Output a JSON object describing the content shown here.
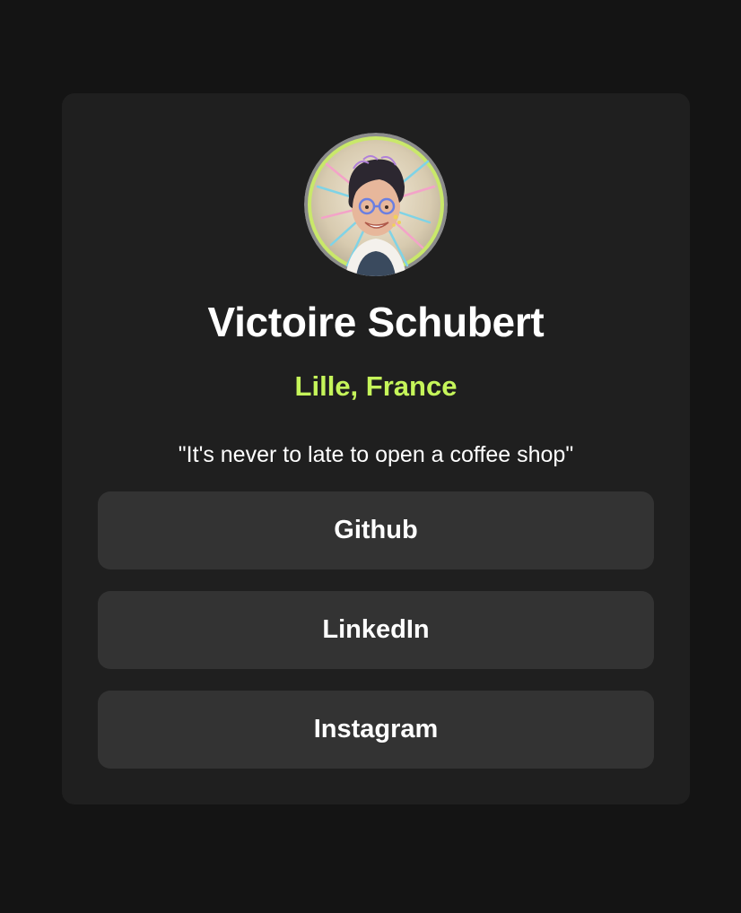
{
  "profile": {
    "name": "Victoire Schubert",
    "location": "Lille, France",
    "bio": "\"It's never to late to open a coffee shop\"",
    "avatar_icon": "profile-photo"
  },
  "links": [
    {
      "label": "Github"
    },
    {
      "label": "LinkedIn"
    },
    {
      "label": "Instagram"
    }
  ],
  "colors": {
    "background": "#141414",
    "card": "#1f1f1f",
    "button": "#333333",
    "accent": "#c5f55a",
    "text": "#ffffff"
  }
}
